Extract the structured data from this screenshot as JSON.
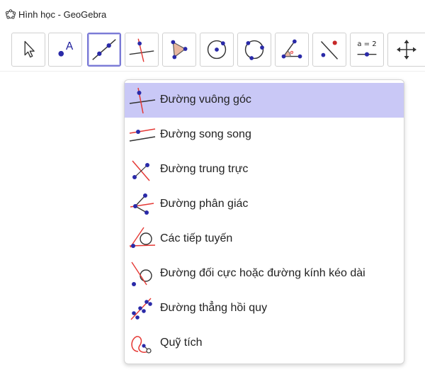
{
  "window": {
    "title": "Hình học - GeoGebra",
    "icon": "geogebra-logo-icon"
  },
  "toolbar": {
    "tools": [
      {
        "name": "move-tool",
        "icon": "cursor-arrow-icon",
        "selected": false
      },
      {
        "name": "point-tool",
        "icon": "point-a-icon",
        "label": "A",
        "selected": false
      },
      {
        "name": "line-tool",
        "icon": "line-through-two-points-icon",
        "selected": true
      },
      {
        "name": "perpendicular-line-tool",
        "icon": "perpendicular-line-icon",
        "selected": false
      },
      {
        "name": "polygon-tool",
        "icon": "polygon-icon",
        "selected": false
      },
      {
        "name": "circle-center-point-tool",
        "icon": "circle-center-point-icon",
        "selected": false
      },
      {
        "name": "circle-three-points-tool",
        "icon": "circle-three-points-icon",
        "selected": false
      },
      {
        "name": "angle-tool",
        "icon": "angle-icon",
        "selected": false
      },
      {
        "name": "reflect-tool",
        "icon": "reflect-about-line-icon",
        "selected": false
      },
      {
        "name": "slider-tool",
        "icon": "slider-icon",
        "label": "a = 2",
        "selected": false
      },
      {
        "name": "move-graphics-tool",
        "icon": "move-graphics-view-icon",
        "selected": false
      }
    ]
  },
  "menu": {
    "items": [
      {
        "label": "Đường vuông góc",
        "icon": "perpendicular-line-icon",
        "active": true
      },
      {
        "label": "Đường song song",
        "icon": "parallel-line-icon",
        "active": false
      },
      {
        "label": "Đường trung trực",
        "icon": "perpendicular-bisector-icon",
        "active": false
      },
      {
        "label": "Đường phân giác",
        "icon": "angle-bisector-icon",
        "active": false
      },
      {
        "label": "Các tiếp tuyến",
        "icon": "tangents-icon",
        "active": false
      },
      {
        "label": "Đường đối cực hoặc đường kính kéo dài",
        "icon": "polar-diameter-line-icon",
        "active": false
      },
      {
        "label": "Đường thẳng hồi quy",
        "icon": "best-fit-line-icon",
        "active": false
      },
      {
        "label": "Quỹ tích",
        "icon": "locus-icon",
        "active": false
      }
    ]
  },
  "colors": {
    "accent_blue": "#1a237e",
    "point_blue": "#2a2aa8",
    "line_red": "#e53935",
    "active_row": "#c9c8f6",
    "selected_border": "#7a7ad6",
    "polygon_fill": "#e8b7a0"
  }
}
